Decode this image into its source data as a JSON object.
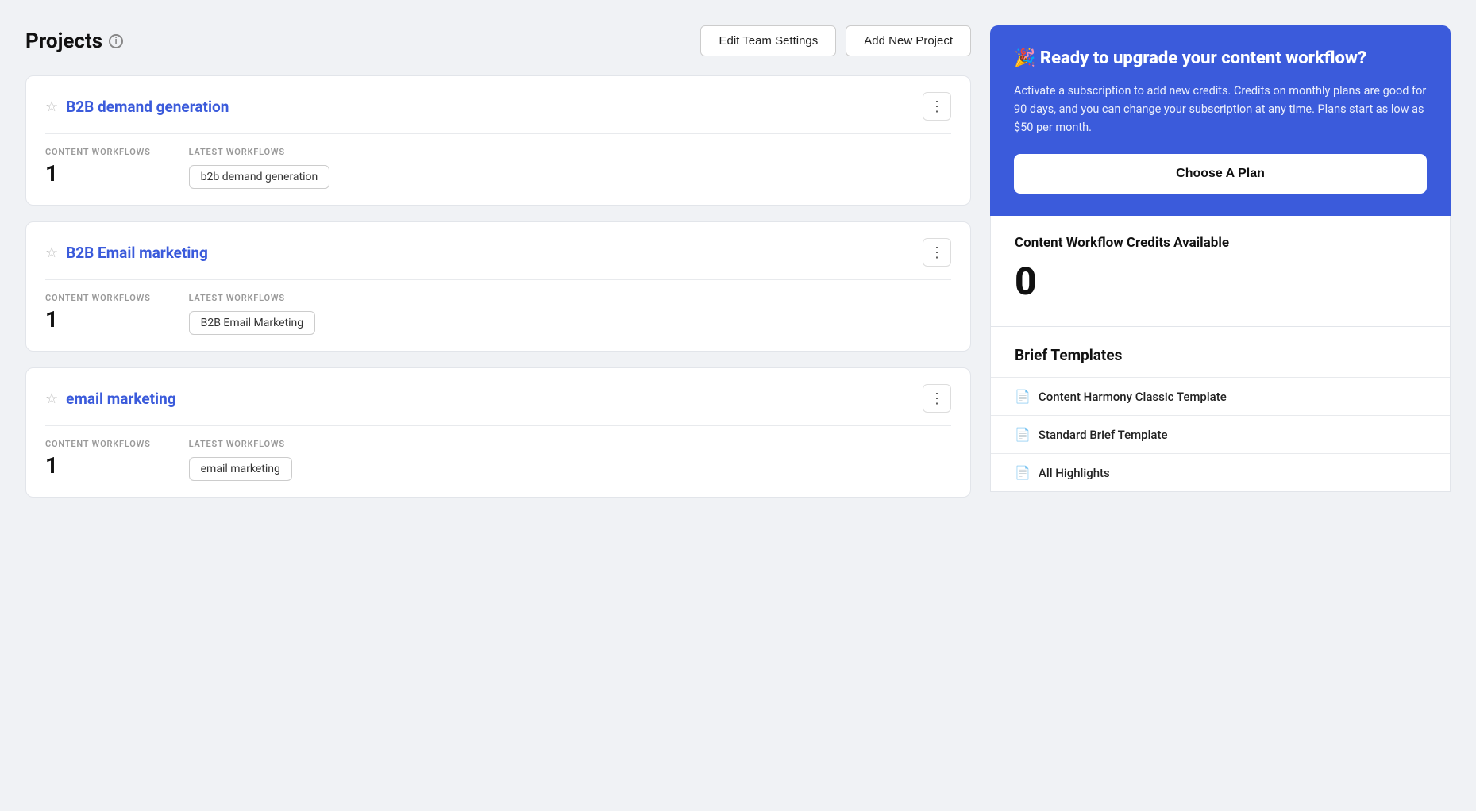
{
  "page": {
    "title": "Projects",
    "info_icon": "i"
  },
  "header": {
    "edit_team_settings_label": "Edit Team Settings",
    "add_new_project_label": "Add New Project"
  },
  "projects": [
    {
      "id": "b2b-demand",
      "name": "B2B demand generation",
      "content_workflows_label": "CONTENT WORKFLOWS",
      "content_workflows_count": "1",
      "latest_workflows_label": "LATEST WORKFLOWS",
      "latest_workflow_badge": "b2b demand generation"
    },
    {
      "id": "b2b-email",
      "name": "B2B Email marketing",
      "content_workflows_label": "CONTENT WORKFLOWS",
      "content_workflows_count": "1",
      "latest_workflows_label": "LATEST WORKFLOWS",
      "latest_workflow_badge": "B2B Email Marketing"
    },
    {
      "id": "email-marketing",
      "name": "email marketing",
      "content_workflows_label": "CONTENT WORKFLOWS",
      "content_workflows_count": "1",
      "latest_workflows_label": "LATEST WORKFLOWS",
      "latest_workflow_badge": "email marketing"
    }
  ],
  "upgrade_panel": {
    "party_icon": "🎉",
    "title": "Ready to upgrade your content workflow?",
    "description": "Activate a subscription to add new credits. Credits on monthly plans are good for 90 days, and you can change your subscription at any time. Plans start as low as $50 per month.",
    "cta_label": "Choose A Plan"
  },
  "credits_panel": {
    "title": "Content Workflow Credits Available",
    "value": "0"
  },
  "brief_templates": {
    "header": "Brief Templates",
    "items": [
      {
        "icon": "📄",
        "name": "Content Harmony Classic Template"
      },
      {
        "icon": "📄",
        "name": "Standard Brief Template"
      },
      {
        "icon": "📄",
        "name": "All Highlights"
      }
    ]
  }
}
